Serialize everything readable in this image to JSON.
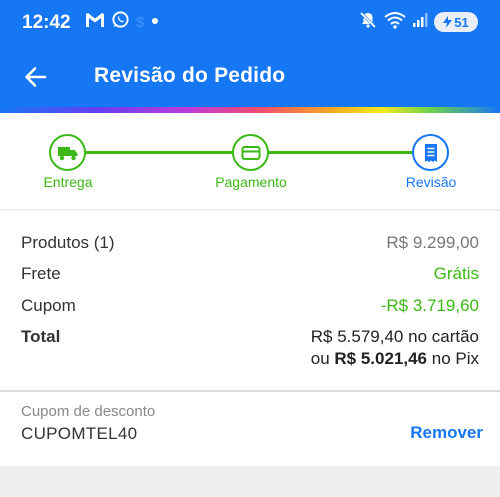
{
  "status_bar": {
    "time": "12:42",
    "left_icons": [
      "gmail-icon",
      "whatsapp-icon",
      "dollar-icon",
      "dot-icon"
    ],
    "right_icons": [
      "mute-icon",
      "wifi-icon",
      "signal-icon"
    ],
    "battery": "51"
  },
  "app_bar": {
    "title": "Revisão do Pedido",
    "back_icon": "arrow-left-icon"
  },
  "colors": {
    "primary": "#1677f5",
    "success": "#3cb815",
    "muted": "#777777"
  },
  "stepper": {
    "steps": [
      {
        "label": "Entrega",
        "icon": "truck-icon",
        "state": "done"
      },
      {
        "label": "Pagamento",
        "icon": "card-icon",
        "state": "done"
      },
      {
        "label": "Revisão",
        "icon": "receipt-icon",
        "state": "current"
      }
    ]
  },
  "summary": {
    "products_label": "Produtos (1)",
    "products_value": "R$ 9.299,00",
    "shipping_label": "Frete",
    "shipping_value": "Grátis",
    "coupon_label": "Cupom",
    "coupon_value": "-R$ 3.719,60",
    "total_label": "Total",
    "total_card_amount": "R$ 5.579,40",
    "total_card_suffix": " no cartão",
    "total_pix_prefix": "ou ",
    "total_pix_amount": "R$ 5.021,46",
    "total_pix_suffix": " no Pix"
  },
  "coupon": {
    "field_label": "Cupom de desconto",
    "code": "CUPOMTEL40",
    "remove_label": "Remover"
  }
}
